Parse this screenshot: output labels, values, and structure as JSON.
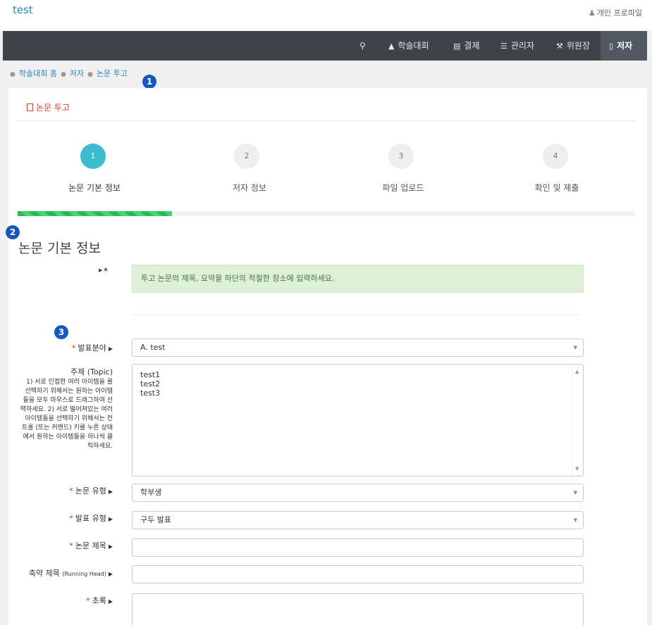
{
  "header": {
    "brand": "test",
    "profile_label": "개인 프로파일"
  },
  "navbar": {
    "search_glyph": "search-icon",
    "items": [
      {
        "label": "학술대회",
        "icon": "graduation-cap-icon"
      },
      {
        "label": "결제",
        "icon": "credit-card-icon"
      },
      {
        "label": "관리자",
        "icon": "list-icon"
      },
      {
        "label": "위원장",
        "icon": "gavel-icon"
      },
      {
        "label": "저자",
        "icon": "book-icon",
        "active": true
      }
    ]
  },
  "breadcrumb": [
    "학술대회 홈",
    "저자",
    "논문 투고"
  ],
  "badges": [
    "1",
    "2",
    "3"
  ],
  "card": {
    "title": "논문 투고"
  },
  "steps": [
    {
      "num": "1",
      "label": "논문 기본 정보",
      "active": true
    },
    {
      "num": "2",
      "label": "저자 정보"
    },
    {
      "num": "3",
      "label": "파일 업로드"
    },
    {
      "num": "4",
      "label": "확인 및 제출"
    }
  ],
  "progress_fraction": 0.25,
  "section_title": "논문 기본 정보",
  "alert_text": "투고 논문의 제목, 요약을 하단의 적절한 장소에 입력하세요.",
  "form": {
    "field_area": {
      "label": "발표분야",
      "value": "A. test"
    },
    "topic": {
      "label": "주제 (Topic)",
      "help": "1) 서로 인접한 여러 아이템을 를 선택하기 위해서는 원하는 아이템들을 모두 마우스로 드래그하여 선택하세요. 2) 서로 떨어져있는 여러 아이템들을 선택하기 위해서는 컨트롤 (또는 커맨드) 키를 누른 상태에서 원하는 아이템들을 하나씩 클릭하세요.",
      "options": [
        "test1",
        "test2",
        "test3"
      ]
    },
    "paper_type": {
      "label": "논문 유형",
      "value": "학부생"
    },
    "presentation_type": {
      "label": "발표 유형",
      "value": "구두 발표"
    },
    "paper_title": {
      "label": "논문 제목"
    },
    "running_head": {
      "label": "축약 제목",
      "small": "(Running Head)"
    },
    "abstract": {
      "label": "초록"
    }
  }
}
